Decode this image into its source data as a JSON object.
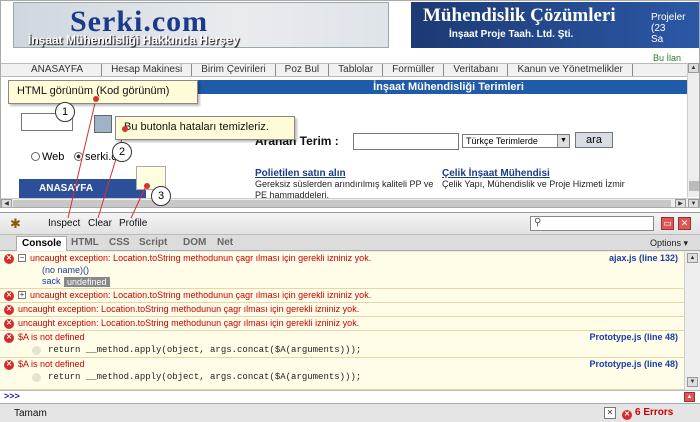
{
  "site": {
    "logo_text": "Serki.com",
    "logo_subtitle": "İnşaat Mühendisliği Hakkında Herşey",
    "banner_title": "Mühendislik Çözümleri",
    "banner_subtitle": "İnşaat Proje Taah. Ltd. Şti.",
    "banner_right_line1": "Projeler",
    "banner_right_line2": "(23",
    "banner_right_line3": "Sa",
    "ad_label": "Bu İlan",
    "nav": [
      "ANASAYFA",
      "Hesap Makinesi",
      "Birim Çevirileri",
      "Poz Bul",
      "Tablolar",
      "Formüller",
      "Veritabanı",
      "Kanun ve Yönetmelikler"
    ],
    "section_title": "İnşaat Mühendisliği Terimleri",
    "radio_web": "Web",
    "radio_serki": "serki.co",
    "side_menu": "ANASAYFA",
    "aranan_label": "Aranan Terim :",
    "lang_select": "Türkçe Terimlerde",
    "ara_button": "ara",
    "card1_title": "Polietilen satın alın",
    "card1_text": "Gereksiz süslerden arındırılmış kaliteli PP ve PE hammaddeleri.",
    "card2_title": "Çelik İnşaat Mühendisi",
    "card2_text": "Çelik Yapı, Mühendislik ve Proje Hizmeti İzmir"
  },
  "callouts": {
    "c1": "HTML görünüm (Kod görünüm)",
    "c2": "Bu butonla hataları temizleriz.",
    "n1": "1",
    "n2": "2",
    "n3": "3"
  },
  "firebug": {
    "toolbar": {
      "inspect": "Inspect",
      "clear": "Clear",
      "profile": "Profile"
    },
    "tabs": [
      "Console",
      "HTML",
      "CSS",
      "Script",
      "DOM",
      "Net"
    ],
    "options": "Options ▾",
    "rows": [
      {
        "msg": "uncaught exception: Location.toString methodunun çagr ılması için gerekli izniniz yok.",
        "src": "ajax.js (line 132)",
        "sub1": "(no name)()",
        "sub2": "sack",
        "tooltip": "undefined"
      },
      {
        "msg": "uncaught exception: Location.toString methodunun çagr ılması için gerekli izniniz yok."
      },
      {
        "msg": "uncaught exception: Location.toString methodunun çagr ılması için gerekli izniniz yok."
      },
      {
        "msg": "uncaught exception: Location.toString methodunun çagr ılması için gerekli izniniz yok."
      },
      {
        "msg": "$A is not defined",
        "src": "Prototype.js (line 48)",
        "code": "return __method.apply(object, args.concat($A(arguments)));"
      },
      {
        "msg": "$A is not defined",
        "src": "Prototype.js (line 48)",
        "code": "return __method.apply(object, args.concat($A(arguments)));"
      }
    ],
    "prompt": ">>>",
    "status": "Tamam",
    "errors": "6 Errors"
  }
}
